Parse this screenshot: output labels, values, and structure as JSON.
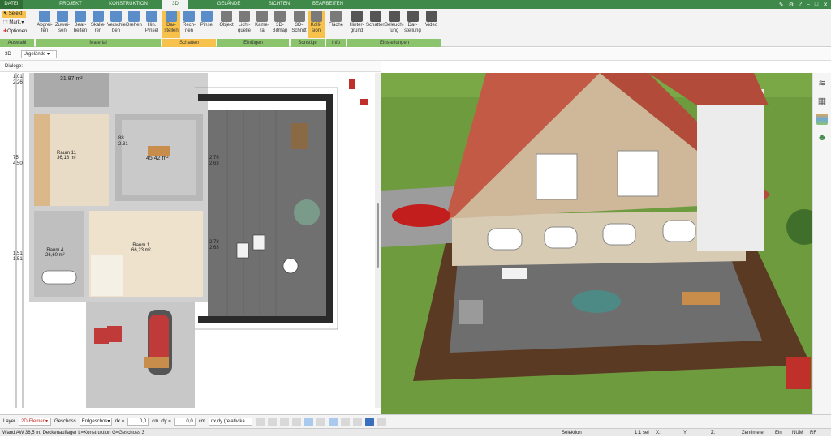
{
  "tabs": [
    "DATEI",
    "PROJEKT",
    "KONSTRUKTION",
    "3D",
    "GELÄNDE",
    "SICHTEN",
    "BEARBEITEN"
  ],
  "active_tab": "3D",
  "ribbon": {
    "auswahl": {
      "selekt": "Selekt",
      "mark": "Mark.",
      "optionen": "Optionen",
      "group": "Auswahl"
    },
    "material": {
      "items": [
        "Abgrei-\nfen",
        "Zuwei-\nsen",
        "Bear-\nbeiten",
        "Skalie-\nren",
        "Verschie-\nben",
        "Drehen",
        "Hin.\nPinsel"
      ],
      "group": "Material"
    },
    "schatten": {
      "items": [
        "Dar-\nstellen",
        "Rech-\nnen",
        "Pinsel"
      ],
      "group": "Schatten"
    },
    "einfuegen": {
      "items": [
        "Objekt",
        "Licht-\nquelle",
        "Kame-\nra",
        "3D-\nBitmap"
      ],
      "group": "Einfügen"
    },
    "sonstige": {
      "items": [
        "3D-\nSchnitt",
        "Kolli-\nsion"
      ],
      "group": "Sonstige"
    },
    "info": {
      "items": [
        "Fläche"
      ],
      "group": "Info"
    },
    "einstellungen": {
      "items": [
        "Hinter-\ngrund",
        "Schatten",
        "Beleuch-\ntung",
        "Dar-\nstellung",
        "Video"
      ],
      "group": "Einstellungen"
    }
  },
  "row2": {
    "mode": "3D",
    "terrain": "Urgelände"
  },
  "row3": {
    "label": "Dialoge:"
  },
  "plan": {
    "rooms": [
      {
        "name": "Raum 11",
        "area": "36,18 m²"
      },
      {
        "name": "",
        "area": "45,42 m²"
      },
      {
        "name": "Raum 4",
        "area": "26,60 m²"
      },
      {
        "name": "Raum 1",
        "area": "66,23 m²"
      },
      {
        "name": "",
        "area": "31,87 m²"
      }
    ],
    "dims": [
      "1.01",
      "2.26",
      "75",
      "4.50",
      "1.51",
      "1.51",
      "2.76",
      "2.63",
      "2.78",
      "2.63",
      "88",
      "2.31"
    ]
  },
  "bottom": {
    "layer_label": "Layer",
    "layer_value": "2D-Elemen",
    "geschoss_label": "Geschoss",
    "geschoss_value": "Erdgeschos",
    "dx_label": "dx =",
    "dx_value": "0,0",
    "dx_unit": "cm",
    "dy_label": "dy =",
    "dy_value": "0,0",
    "dy_unit": "cm",
    "mode_value": "dx,dy (relativ ka"
  },
  "status": {
    "left": "Wand AW 36,5 m, Deckenauflager L=Konstruktion G=Geschoss 3",
    "selektion": "Selektion",
    "scale": "1:1 sel",
    "x": "X:",
    "y": "Y:",
    "z": "Z:",
    "unit": "Zentimeter",
    "ein": "Ein",
    "num": "NUM",
    "rf": "RF"
  },
  "colors": {
    "brand": "#3f8a4a",
    "ribbon_group": "#8cc46d",
    "active": "#f6c24c",
    "grass": "#7da24a",
    "roof": "#b24b3a",
    "terrace": "#6e6e6e"
  }
}
